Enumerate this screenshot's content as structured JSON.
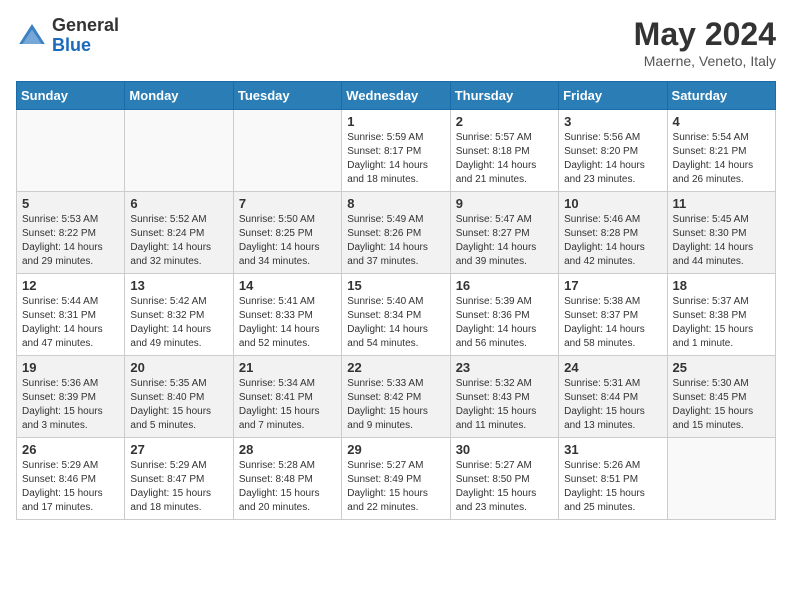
{
  "header": {
    "logo_general": "General",
    "logo_blue": "Blue",
    "month_title": "May 2024",
    "location": "Maerne, Veneto, Italy"
  },
  "days_of_week": [
    "Sunday",
    "Monday",
    "Tuesday",
    "Wednesday",
    "Thursday",
    "Friday",
    "Saturday"
  ],
  "weeks": [
    [
      {
        "day": "",
        "info": ""
      },
      {
        "day": "",
        "info": ""
      },
      {
        "day": "",
        "info": ""
      },
      {
        "day": "1",
        "info": "Sunrise: 5:59 AM\nSunset: 8:17 PM\nDaylight: 14 hours\nand 18 minutes."
      },
      {
        "day": "2",
        "info": "Sunrise: 5:57 AM\nSunset: 8:18 PM\nDaylight: 14 hours\nand 21 minutes."
      },
      {
        "day": "3",
        "info": "Sunrise: 5:56 AM\nSunset: 8:20 PM\nDaylight: 14 hours\nand 23 minutes."
      },
      {
        "day": "4",
        "info": "Sunrise: 5:54 AM\nSunset: 8:21 PM\nDaylight: 14 hours\nand 26 minutes."
      }
    ],
    [
      {
        "day": "5",
        "info": "Sunrise: 5:53 AM\nSunset: 8:22 PM\nDaylight: 14 hours\nand 29 minutes."
      },
      {
        "day": "6",
        "info": "Sunrise: 5:52 AM\nSunset: 8:24 PM\nDaylight: 14 hours\nand 32 minutes."
      },
      {
        "day": "7",
        "info": "Sunrise: 5:50 AM\nSunset: 8:25 PM\nDaylight: 14 hours\nand 34 minutes."
      },
      {
        "day": "8",
        "info": "Sunrise: 5:49 AM\nSunset: 8:26 PM\nDaylight: 14 hours\nand 37 minutes."
      },
      {
        "day": "9",
        "info": "Sunrise: 5:47 AM\nSunset: 8:27 PM\nDaylight: 14 hours\nand 39 minutes."
      },
      {
        "day": "10",
        "info": "Sunrise: 5:46 AM\nSunset: 8:28 PM\nDaylight: 14 hours\nand 42 minutes."
      },
      {
        "day": "11",
        "info": "Sunrise: 5:45 AM\nSunset: 8:30 PM\nDaylight: 14 hours\nand 44 minutes."
      }
    ],
    [
      {
        "day": "12",
        "info": "Sunrise: 5:44 AM\nSunset: 8:31 PM\nDaylight: 14 hours\nand 47 minutes."
      },
      {
        "day": "13",
        "info": "Sunrise: 5:42 AM\nSunset: 8:32 PM\nDaylight: 14 hours\nand 49 minutes."
      },
      {
        "day": "14",
        "info": "Sunrise: 5:41 AM\nSunset: 8:33 PM\nDaylight: 14 hours\nand 52 minutes."
      },
      {
        "day": "15",
        "info": "Sunrise: 5:40 AM\nSunset: 8:34 PM\nDaylight: 14 hours\nand 54 minutes."
      },
      {
        "day": "16",
        "info": "Sunrise: 5:39 AM\nSunset: 8:36 PM\nDaylight: 14 hours\nand 56 minutes."
      },
      {
        "day": "17",
        "info": "Sunrise: 5:38 AM\nSunset: 8:37 PM\nDaylight: 14 hours\nand 58 minutes."
      },
      {
        "day": "18",
        "info": "Sunrise: 5:37 AM\nSunset: 8:38 PM\nDaylight: 15 hours\nand 1 minute."
      }
    ],
    [
      {
        "day": "19",
        "info": "Sunrise: 5:36 AM\nSunset: 8:39 PM\nDaylight: 15 hours\nand 3 minutes."
      },
      {
        "day": "20",
        "info": "Sunrise: 5:35 AM\nSunset: 8:40 PM\nDaylight: 15 hours\nand 5 minutes."
      },
      {
        "day": "21",
        "info": "Sunrise: 5:34 AM\nSunset: 8:41 PM\nDaylight: 15 hours\nand 7 minutes."
      },
      {
        "day": "22",
        "info": "Sunrise: 5:33 AM\nSunset: 8:42 PM\nDaylight: 15 hours\nand 9 minutes."
      },
      {
        "day": "23",
        "info": "Sunrise: 5:32 AM\nSunset: 8:43 PM\nDaylight: 15 hours\nand 11 minutes."
      },
      {
        "day": "24",
        "info": "Sunrise: 5:31 AM\nSunset: 8:44 PM\nDaylight: 15 hours\nand 13 minutes."
      },
      {
        "day": "25",
        "info": "Sunrise: 5:30 AM\nSunset: 8:45 PM\nDaylight: 15 hours\nand 15 minutes."
      }
    ],
    [
      {
        "day": "26",
        "info": "Sunrise: 5:29 AM\nSunset: 8:46 PM\nDaylight: 15 hours\nand 17 minutes."
      },
      {
        "day": "27",
        "info": "Sunrise: 5:29 AM\nSunset: 8:47 PM\nDaylight: 15 hours\nand 18 minutes."
      },
      {
        "day": "28",
        "info": "Sunrise: 5:28 AM\nSunset: 8:48 PM\nDaylight: 15 hours\nand 20 minutes."
      },
      {
        "day": "29",
        "info": "Sunrise: 5:27 AM\nSunset: 8:49 PM\nDaylight: 15 hours\nand 22 minutes."
      },
      {
        "day": "30",
        "info": "Sunrise: 5:27 AM\nSunset: 8:50 PM\nDaylight: 15 hours\nand 23 minutes."
      },
      {
        "day": "31",
        "info": "Sunrise: 5:26 AM\nSunset: 8:51 PM\nDaylight: 15 hours\nand 25 minutes."
      },
      {
        "day": "",
        "info": ""
      }
    ]
  ]
}
